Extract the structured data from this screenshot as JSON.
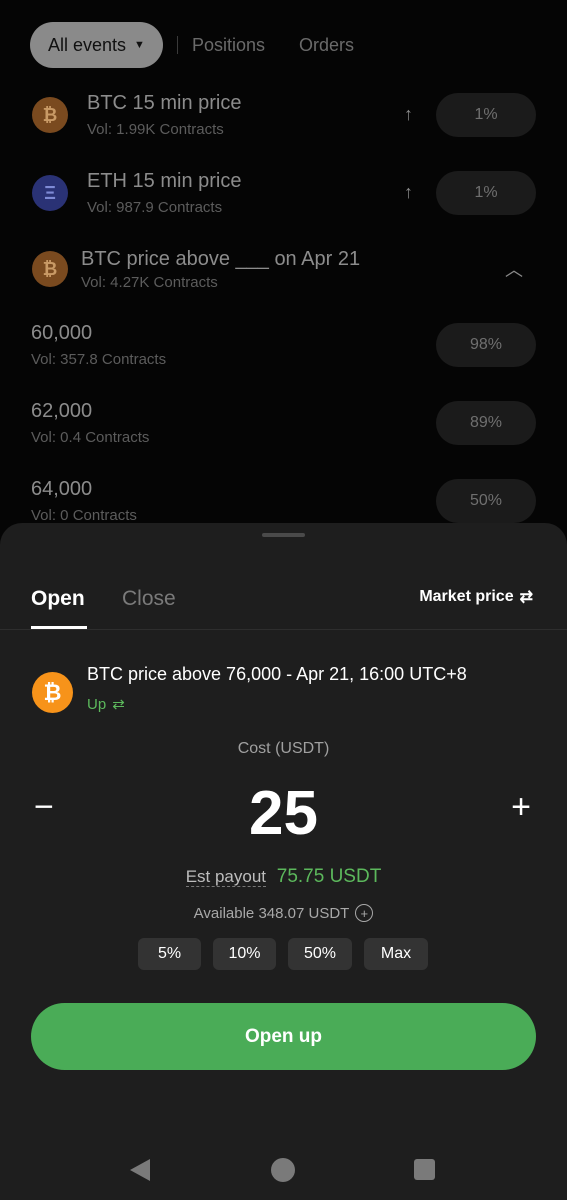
{
  "top_tabs": {
    "filter": "All events",
    "positions": "Positions",
    "orders": "Orders"
  },
  "events": [
    {
      "title": "BTC 15 min price",
      "vol": "Vol: 1.99K Contracts",
      "pct": "1%",
      "coin": "₿"
    },
    {
      "title": "ETH 15 min price",
      "vol": "Vol: 987.9 Contracts",
      "pct": "1%",
      "coin": "Ξ"
    },
    {
      "title": "BTC price above ___ on Apr 21",
      "vol": "Vol: 4.27K Contracts",
      "coin": "₿"
    }
  ],
  "strikes": [
    {
      "price": "60,000",
      "vol": "Vol: 357.8 Contracts",
      "pct": "98%"
    },
    {
      "price": "62,000",
      "vol": "Vol: 0.4 Contracts",
      "pct": "89%"
    },
    {
      "price": "64,000",
      "vol": "Vol: 0 Contracts",
      "pct": "50%"
    }
  ],
  "sheet": {
    "tab_open": "Open",
    "tab_close": "Close",
    "market_price": "Market price",
    "order_title": "BTC price above 76,000 - Apr 21, 16:00 UTC+8",
    "direction": "Up",
    "cost_label": "Cost (USDT)",
    "amount": "25",
    "payout_label": "Est payout",
    "payout_value": "75.75 USDT",
    "available": "Available 348.07 USDT",
    "quick": [
      "5%",
      "10%",
      "50%",
      "Max"
    ],
    "submit": "Open up"
  },
  "colors": {
    "accent_green": "#4aac57",
    "btc_orange": "#f7931a"
  }
}
